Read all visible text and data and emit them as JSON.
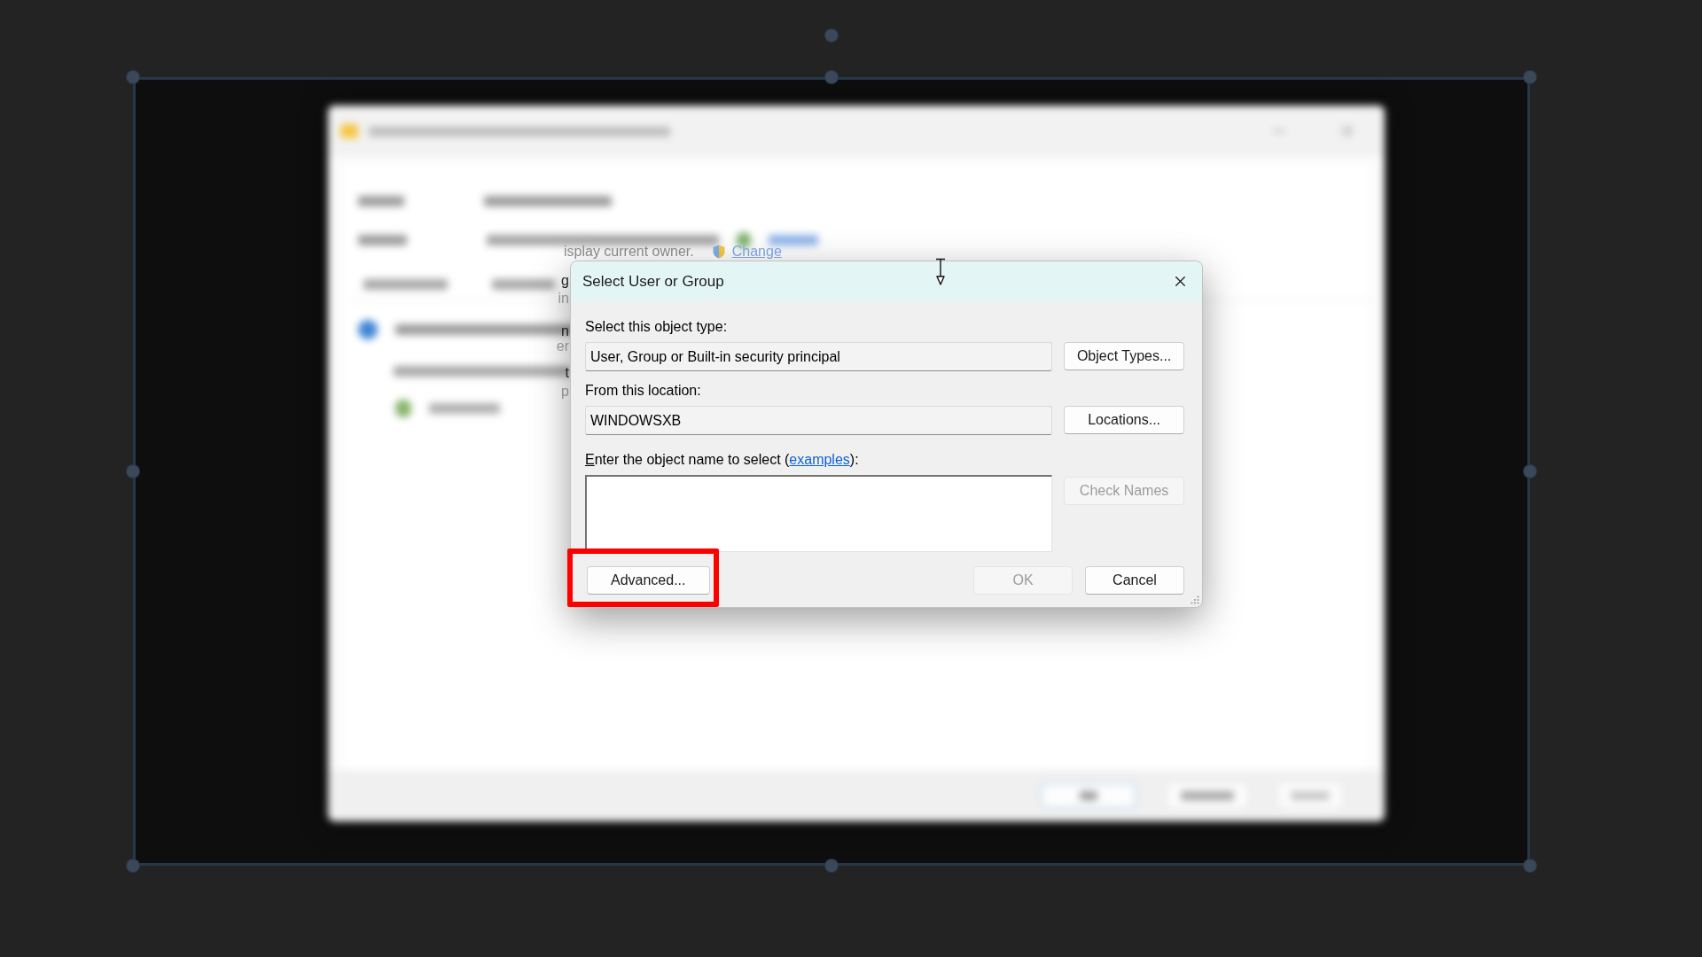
{
  "canvas": {
    "selected": true
  },
  "background_window": {
    "owner_note": "isplay current owner.",
    "change_link": "Change",
    "edge_fragments": [
      {
        "text": "g",
        "faded": false
      },
      {
        "text": "in",
        "faded": true
      },
      {
        "text": "n",
        "faded": false
      },
      {
        "text": "er",
        "faded": true
      },
      {
        "text": "t",
        "faded": false
      },
      {
        "text": "p",
        "faded": true
      }
    ]
  },
  "dialog": {
    "title": "Select User or Group",
    "object_type": {
      "label": "Select this object type:",
      "value": "User, Group or Built-in security principal",
      "button": {
        "label": "Object Types...",
        "disabled": false
      }
    },
    "location": {
      "label": "From this location:",
      "value": "WINDOWSXB",
      "button": {
        "label": "Locations...",
        "disabled": false
      }
    },
    "object_name": {
      "label": "Enter the object name to select (",
      "link": "examples",
      "label_end": "):",
      "button": {
        "label": "Check Names",
        "disabled": true
      }
    },
    "buttons": [
      {
        "label": "Advanced...",
        "disabled": false,
        "highlighted": true
      },
      {
        "label": "OK",
        "disabled": true,
        "highlighted": false
      },
      {
        "label": "Cancel",
        "disabled": false,
        "highlighted": false
      }
    ]
  }
}
